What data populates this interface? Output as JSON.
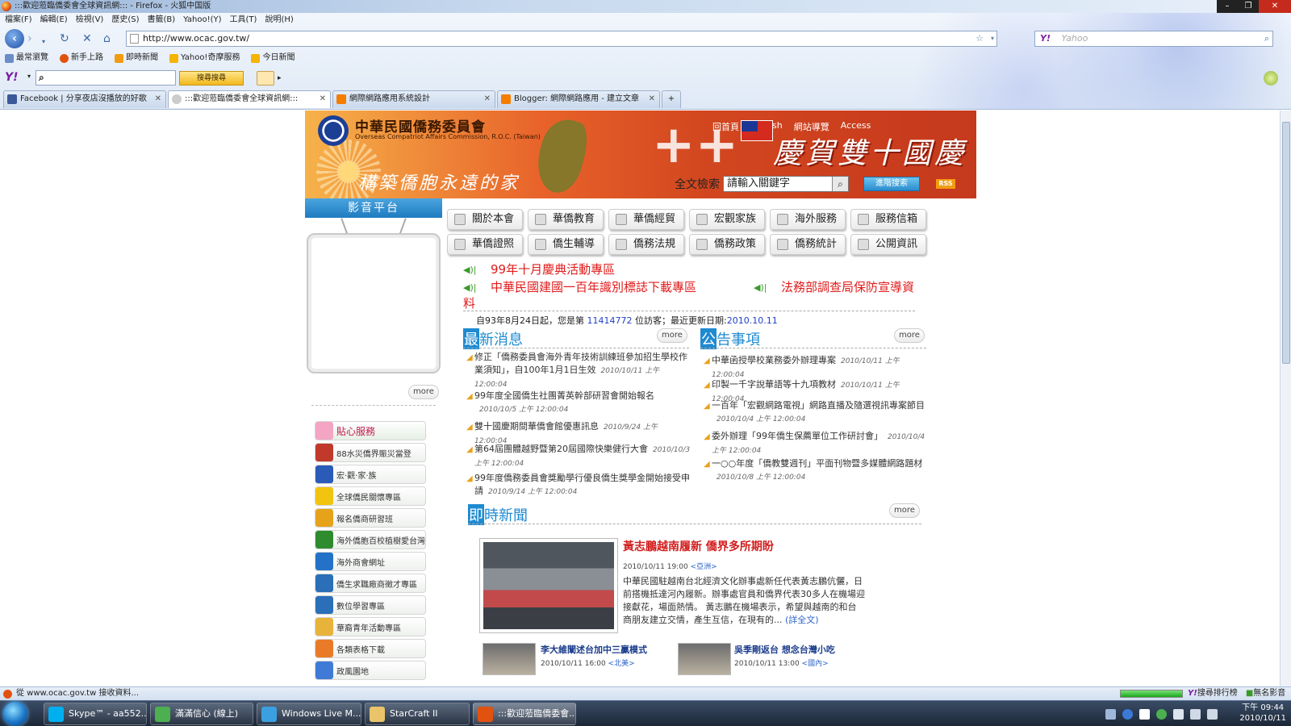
{
  "browser": {
    "title": ":::歡迎蒞臨僑委會全球資訊網::: - Firefox - 火狐中国版",
    "menu": [
      "檔案(F)",
      "編輯(E)",
      "檢視(V)",
      "歷史(S)",
      "書籤(B)",
      "Yahoo!(Y)",
      "工具(T)",
      "說明(H)"
    ],
    "url": "http://www.ocac.gov.tw/",
    "search_placeholder": "Yahoo",
    "bookmarks": [
      "最常瀏覽",
      "新手上路",
      "即時新聞",
      "Yahoo!奇摩服務",
      "今日新聞"
    ],
    "yahoo_search_btn": "搜尋搜尋",
    "tabs": [
      {
        "label": "Facebook | 分享夜店沒播放的好歌",
        "color": "#3b5998"
      },
      {
        "label": ":::歡迎蒞臨僑委會全球資訊網:::",
        "color": "#cccccc"
      },
      {
        "label": "網際網路應用系統設計",
        "color": "#f57d00"
      },
      {
        "label": "Blogger: 網際網路應用 - 建立文章",
        "color": "#f57d00"
      }
    ],
    "status": "從 www.ocac.gov.tw 接收資料...",
    "progress": 1.0,
    "status_right": [
      "搜尋排行榜",
      "無名影音"
    ]
  },
  "site": {
    "org_name": "中華民國僑務委員會",
    "org_en": "Overseas Compatriot Affairs Commission, R.O.C. (Taiwan)",
    "slogan": "構築僑胞永遠的家",
    "celebration": "慶賀雙十國慶",
    "top_links": [
      "回首頁",
      "English",
      "網站導覽",
      "Access"
    ],
    "search_label": "全文檢索",
    "search_value": "請輸入關鍵字",
    "adv_search": "進階搜索",
    "rss": "RSS",
    "av_platform": "影音平台",
    "more": "more",
    "nav_row1": [
      "關於本會",
      "華僑教育",
      "華僑經貿",
      "宏觀家族",
      "海外服務",
      "服務信箱"
    ],
    "nav_row2": [
      "華僑證照",
      "僑生輔導",
      "僑務法規",
      "僑務政策",
      "僑務統計",
      "公開資訊"
    ],
    "announcements": [
      "99年十月慶典活動專區",
      "中華民國建國一百年識別標誌下載專區",
      "法務部調查局保防宣導資",
      "料"
    ],
    "counter": {
      "prefix": "自93年8月24日起，您是第",
      "count": "11414772",
      "mid": "位訪客；最近更新日期:",
      "date": "2010.10.11"
    },
    "latest_news": {
      "head_first": "最",
      "head_rest": "新消息",
      "items": [
        {
          "title": "修正「僑務委員會海外青年技術訓練班參加招生學校作業須知」，自100年1月1日生效",
          "date": "2010/10/11 上午 12:00:04"
        },
        {
          "title": "99年度全國僑生社團菁英幹部研習會開始報名",
          "date": "2010/10/5 上午 12:00:04"
        },
        {
          "title": "雙十國慶期間華僑會館優惠訊息",
          "date": "2010/9/24 上午 12:00:04"
        },
        {
          "title": "第64屆團體越野暨第20屆國際快樂健行大會",
          "date": "2010/10/3 上午 12:00:04"
        },
        {
          "title": "99年度僑務委員會獎勵學行優良僑生獎學金開始接受申請",
          "date": "2010/9/14 上午 12:00:04"
        }
      ]
    },
    "notices": {
      "head_first": "公",
      "head_rest": "告事項",
      "items": [
        {
          "title": "中華函授學校業務委外辦理專案",
          "date": "2010/10/11 上午 12:00:04"
        },
        {
          "title": "印製一千字說華語等十九項教材",
          "date": "2010/10/11 上午 12:00:04"
        },
        {
          "title": "一百年「宏觀網路電視」網路直播及隨選視訊專案節目",
          "date": "2010/10/4 上午 12:00:04"
        },
        {
          "title": "委外辦理「99年僑生保薦單位工作研討會」",
          "date": "2010/10/4 上午 12:00:04"
        },
        {
          "title": "一○○年度「僑教雙週刊」平面刊物暨多媒體網路題材",
          "date": "2010/10/8 上午 12:00:04"
        }
      ]
    },
    "instant_news": {
      "head_first": "即",
      "head_rest": "時新聞",
      "headline": "黃志鵬越南履新 僑界多所期盼",
      "date": "2010/10/11 19:00",
      "tag": "<亞洲>",
      "body": "中華民國駐越南台北經濟文化辦事處新任代表黃志鵬伉儷，日前搭機抵達河內履新。辦事處官員和僑界代表30多人在機場迎接獻花，場面熱情。 黃志鵬在機場表示，希望與越南的和台商朋友建立交情，產生互信，在現有的...",
      "full": "(詳全文)",
      "sub": [
        {
          "headline": "李大維闡述台加中三贏模式",
          "date": "2010/10/11 16:00",
          "tag": "<北美>"
        },
        {
          "headline": "吳季剛返台 想念台灣小吃",
          "date": "2010/10/11 13:00",
          "tag": "<國內>"
        }
      ]
    },
    "services": [
      {
        "label": "貼心服務",
        "color": "#f4a5c4"
      },
      {
        "label": "88水災僑界賑災當登",
        "color": "#c0392b"
      },
      {
        "label": "宏‧觀‧家‧族",
        "color": "#2a5bb8"
      },
      {
        "label": "全球僑民關懷專區",
        "color": "#f1c40f"
      },
      {
        "label": "報名僑商研習班",
        "color": "#e6a31a"
      },
      {
        "label": "海外僑胞百校植樹愛台灣",
        "color": "#2e8b2e"
      },
      {
        "label": "海外商會網址",
        "color": "#2472c8"
      },
      {
        "label": "僑生求職廠商徵才專區",
        "color": "#2a6fb8"
      },
      {
        "label": "數位學習專區",
        "color": "#2a6fb8"
      },
      {
        "label": "華裔青年活動專區",
        "color": "#e8b33a"
      },
      {
        "label": "各類表格下載",
        "color": "#e97b28"
      },
      {
        "label": "政風園地",
        "color": "#3f7bd6"
      }
    ]
  },
  "taskbar": {
    "buttons": [
      {
        "label": "Skype™ - aa552...",
        "color": "#00aff0"
      },
      {
        "label": "滿滿信心 (線上)",
        "color": "#4caf50"
      },
      {
        "label": "Windows Live M...",
        "color": "#3aa0e0"
      },
      {
        "label": "StarCraft II",
        "color": "#e9c46a"
      },
      {
        "label": ":::歡迎蒞臨僑委會...",
        "color": "#e2520f"
      }
    ],
    "time": "下午 09:44",
    "date": "2010/10/11"
  }
}
